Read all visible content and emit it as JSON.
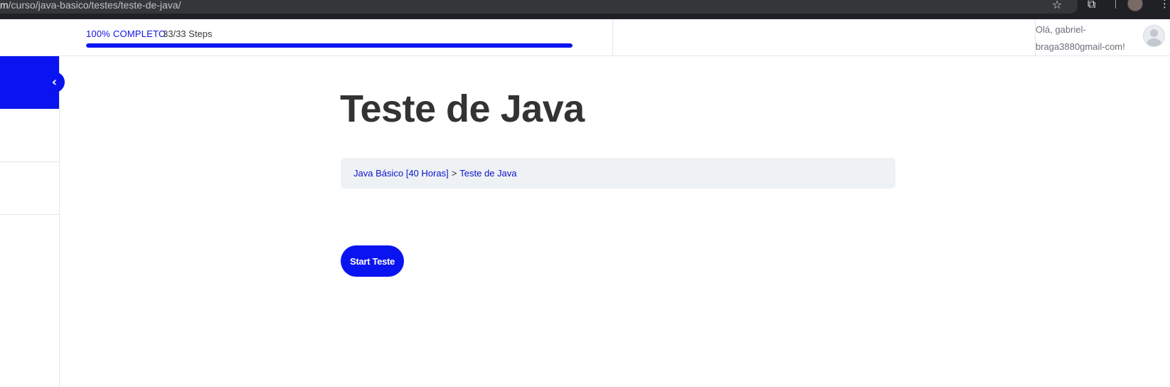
{
  "browser": {
    "url_host": "m",
    "url_path": "/curso/java-basico/testes/teste-de-java/",
    "icons": [
      "star-icon",
      "extensions-icon",
      "profile-avatar",
      "more-vert-icon"
    ]
  },
  "header": {
    "progress_label": "100% COMPLETO",
    "progress_steps": "33/33 Steps",
    "progress_value": 1.0,
    "greeting": "Olá, gabriel-braga3880gmail-com!"
  },
  "sidebar": {
    "collapse_icon": "chevron-left-icon"
  },
  "main": {
    "title": "Teste de Java",
    "breadcrumb": {
      "course": "Java Básico [40 Horas]",
      "separator": ">",
      "current": "Teste de Java"
    },
    "start_button": "Start Teste"
  },
  "colors": {
    "accent": "#0a14f0",
    "title": "#333333",
    "breadcrumb_bg": "#eff2f5",
    "browser_bg": "#202124"
  }
}
